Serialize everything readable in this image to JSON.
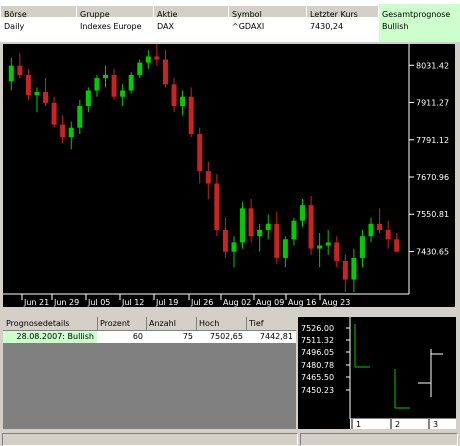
{
  "header": {
    "labels": [
      "Börse",
      "Gruppe",
      "Aktie",
      "Symbol",
      "Letzter Kurs",
      "Gesamtprognose"
    ],
    "values": [
      "Daily",
      "Indexes Europe",
      "DAX",
      "^GDAXI",
      "7430,24",
      "Bullish"
    ]
  },
  "chart": {
    "y_ticks": [
      "8031.42",
      "7911.27",
      "7791.12",
      "7670.96",
      "7550.81",
      "7430.65"
    ],
    "x_ticks": [
      "Jun 21",
      "Jun 29",
      "Jul 05",
      "Jul 12",
      "Jul 19",
      "Jul 26",
      "Aug 02",
      "Aug 09",
      "Aug 16",
      "Aug 23"
    ],
    "colors": {
      "up": "#00cc00",
      "down": "#cc2222",
      "bg": "#000000",
      "axis": "#ffffff"
    },
    "candles": [
      {
        "o": 7980,
        "h": 8055,
        "l": 7950,
        "c": 8030
      },
      {
        "o": 8030,
        "h": 8070,
        "l": 7990,
        "c": 8000
      },
      {
        "o": 8000,
        "h": 8020,
        "l": 7920,
        "c": 7935
      },
      {
        "o": 7935,
        "h": 7960,
        "l": 7880,
        "c": 7945
      },
      {
        "o": 7945,
        "h": 7990,
        "l": 7900,
        "c": 7910
      },
      {
        "o": 7910,
        "h": 7930,
        "l": 7830,
        "c": 7840
      },
      {
        "o": 7840,
        "h": 7870,
        "l": 7780,
        "c": 7800
      },
      {
        "o": 7800,
        "h": 7850,
        "l": 7760,
        "c": 7830
      },
      {
        "o": 7830,
        "h": 7920,
        "l": 7810,
        "c": 7900
      },
      {
        "o": 7900,
        "h": 7960,
        "l": 7880,
        "c": 7950
      },
      {
        "o": 7950,
        "h": 8000,
        "l": 7930,
        "c": 7990
      },
      {
        "o": 7990,
        "h": 8030,
        "l": 7960,
        "c": 8000
      },
      {
        "o": 8000,
        "h": 8020,
        "l": 7920,
        "c": 7930
      },
      {
        "o": 7930,
        "h": 7970,
        "l": 7900,
        "c": 7950
      },
      {
        "o": 7950,
        "h": 8010,
        "l": 7940,
        "c": 8000
      },
      {
        "o": 8000,
        "h": 8050,
        "l": 7990,
        "c": 8040
      },
      {
        "o": 8040,
        "h": 8080,
        "l": 8020,
        "c": 8060
      },
      {
        "o": 8060,
        "h": 8100,
        "l": 8030,
        "c": 8050
      },
      {
        "o": 8050,
        "h": 8080,
        "l": 7960,
        "c": 7970
      },
      {
        "o": 7970,
        "h": 7990,
        "l": 7880,
        "c": 7900
      },
      {
        "o": 7900,
        "h": 7950,
        "l": 7870,
        "c": 7930
      },
      {
        "o": 7930,
        "h": 7960,
        "l": 7800,
        "c": 7810
      },
      {
        "o": 7810,
        "h": 7830,
        "l": 7650,
        "c": 7690
      },
      {
        "o": 7690,
        "h": 7720,
        "l": 7600,
        "c": 7650
      },
      {
        "o": 7650,
        "h": 7680,
        "l": 7480,
        "c": 7500
      },
      {
        "o": 7500,
        "h": 7540,
        "l": 7410,
        "c": 7430
      },
      {
        "o": 7430,
        "h": 7480,
        "l": 7380,
        "c": 7460
      },
      {
        "o": 7460,
        "h": 7590,
        "l": 7440,
        "c": 7570
      },
      {
        "o": 7570,
        "h": 7600,
        "l": 7460,
        "c": 7480
      },
      {
        "o": 7480,
        "h": 7520,
        "l": 7430,
        "c": 7500
      },
      {
        "o": 7500,
        "h": 7550,
        "l": 7470,
        "c": 7520
      },
      {
        "o": 7520,
        "h": 7560,
        "l": 7390,
        "c": 7410
      },
      {
        "o": 7410,
        "h": 7480,
        "l": 7380,
        "c": 7470
      },
      {
        "o": 7470,
        "h": 7540,
        "l": 7450,
        "c": 7530
      },
      {
        "o": 7530,
        "h": 7600,
        "l": 7510,
        "c": 7580
      },
      {
        "o": 7580,
        "h": 7610,
        "l": 7420,
        "c": 7440
      },
      {
        "o": 7440,
        "h": 7490,
        "l": 7380,
        "c": 7450
      },
      {
        "o": 7450,
        "h": 7500,
        "l": 7420,
        "c": 7460
      },
      {
        "o": 7460,
        "h": 7480,
        "l": 7380,
        "c": 7400
      },
      {
        "o": 7400,
        "h": 7420,
        "l": 7300,
        "c": 7340
      },
      {
        "o": 7340,
        "h": 7440,
        "l": 7300,
        "c": 7410
      },
      {
        "o": 7410,
        "h": 7500,
        "l": 7380,
        "c": 7480
      },
      {
        "o": 7480,
        "h": 7540,
        "l": 7460,
        "c": 7520
      },
      {
        "o": 7520,
        "h": 7570,
        "l": 7490,
        "c": 7500
      },
      {
        "o": 7500,
        "h": 7530,
        "l": 7440,
        "c": 7470
      },
      {
        "o": 7470,
        "h": 7490,
        "l": 7430,
        "c": 7430
      }
    ]
  },
  "details": {
    "columns": [
      "Prognosedetails",
      "Prozent",
      "Anzahl",
      "Hoch",
      "Tief"
    ],
    "rows": [
      [
        "28.08.2007: Bullish",
        "60",
        "75",
        "7502,65",
        "7442,81"
      ]
    ]
  },
  "mini": {
    "y_ticks": [
      "7526.00",
      "7511.32",
      "7496.05",
      "7480.78",
      "7465.50",
      "7450.23"
    ],
    "x_ticks": [
      "1",
      "2",
      "3"
    ]
  }
}
